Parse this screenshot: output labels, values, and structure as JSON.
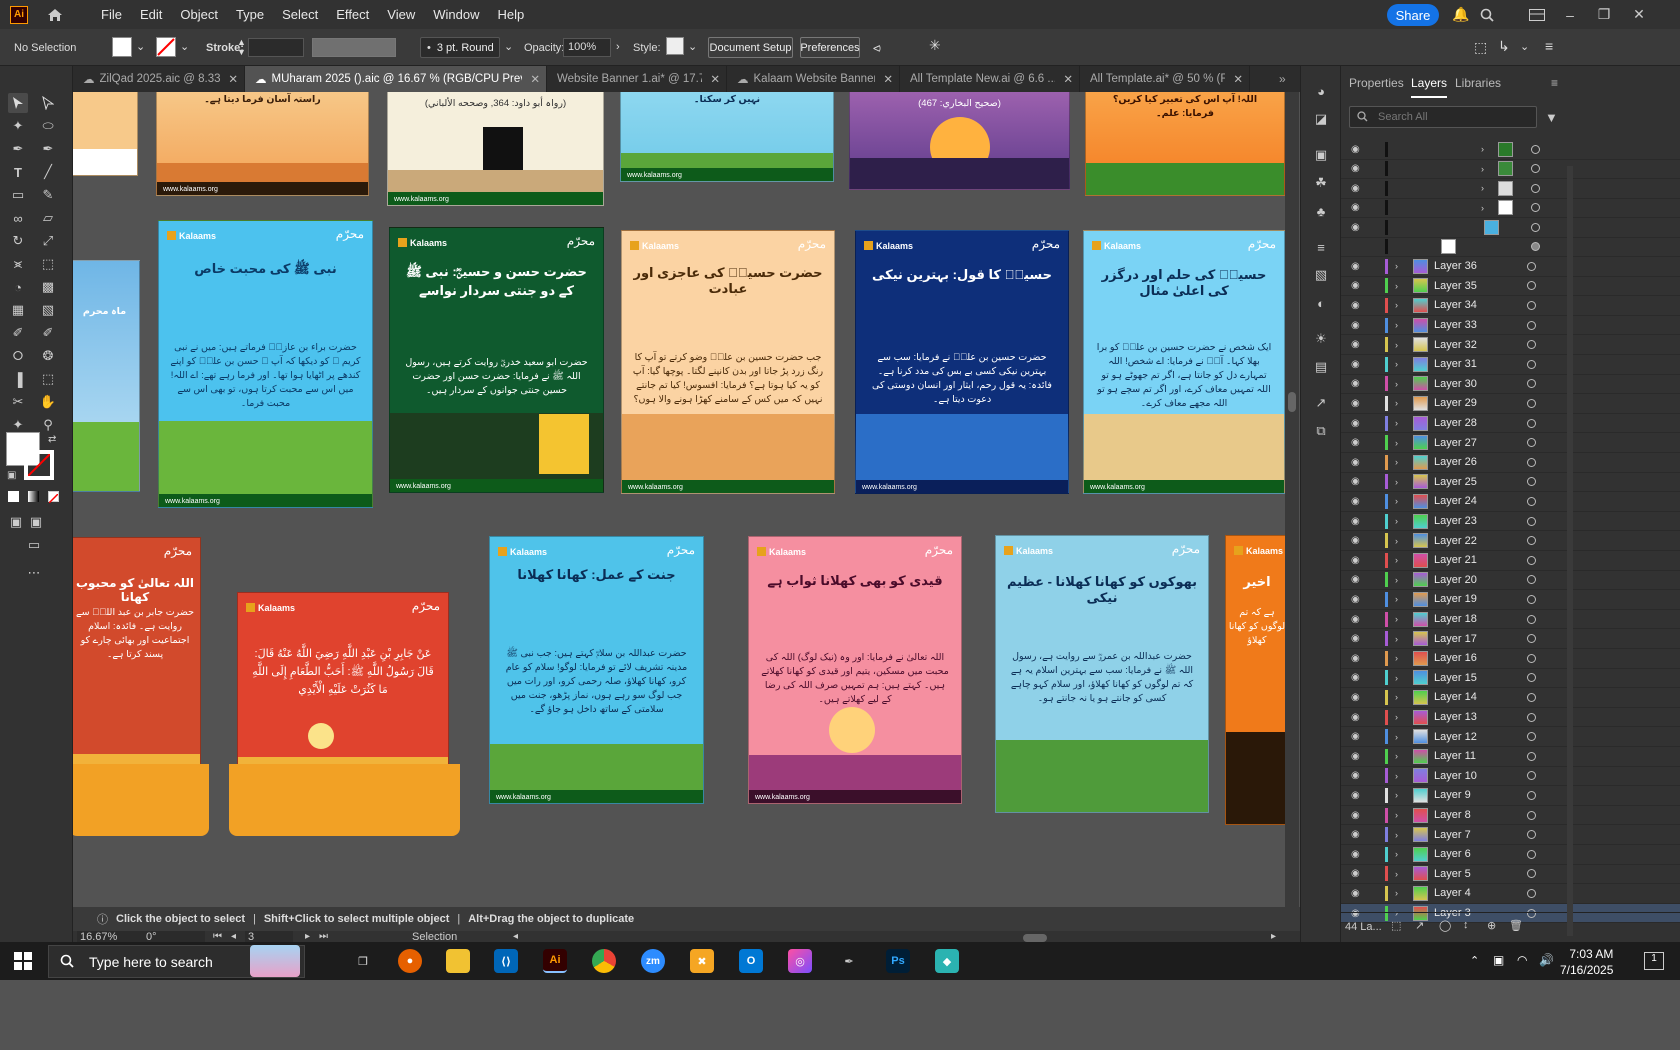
{
  "app": {
    "logo": "Ai",
    "menus": [
      "File",
      "Edit",
      "Object",
      "Type",
      "Select",
      "Effect",
      "View",
      "Window",
      "Help"
    ],
    "share_label": "Share"
  },
  "control": {
    "selection": "No Selection",
    "stroke_label": "Stroke:",
    "brush": "3 pt. Round",
    "opacity_label": "Opacity:",
    "opacity": "100%",
    "style_label": "Style:",
    "doc_setup": "Document Setup",
    "preferences": "Preferences"
  },
  "tabs": [
    {
      "label": "ZilQad 2025.aic @ 8.33 ...",
      "active": false
    },
    {
      "label": "MUharam 2025 ().aic @ 16.67 % (RGB/CPU Preview)",
      "active": true
    },
    {
      "label": "Website Banner 1.ai* @ 17.7...",
      "active": false
    },
    {
      "label": "Kalaam Website Banner.aic",
      "active": false
    },
    {
      "label": "All Template New.ai @ 6.6 ...",
      "active": false
    },
    {
      "label": "All Template.ai* @ 50 % (RG...",
      "active": false
    }
  ],
  "artboards": {
    "brand": "Kalaams",
    "mh": "محرّم",
    "url": "www.kalaams.org",
    "r1": [
      {
        "body": "راستہ آسان فرما دیتا ہے۔",
        "bg": "#f2a154",
        "sky": "#f7c98a",
        "ground": "#d97a33"
      },
      {
        "body": "(رواہ أبو داود: 364, وصححه الألباني)",
        "bg": "#e9e2cf",
        "sky": "#f5efdc",
        "ground": "#caa97a"
      },
      {
        "body": "نہیں کر سکتا۔",
        "bg": "#6ec9e8",
        "sky": "#8fd8f0",
        "ground": "#5aa63a"
      },
      {
        "body": "(صحیح البخاري: 467)",
        "bg": "#5b3a8a",
        "sky": "#8a4b9e",
        "ground": "#2e1f4a"
      },
      {
        "body": "اللہ! آپ اس کی تعبیر کیا کریں؟ فرمایا: علم۔",
        "bg": "#f47b20",
        "sky": "#f9a54a",
        "ground": "#3a8d2b"
      }
    ],
    "r2": [
      {
        "title": "نبی ﷺ کی محبت خاص",
        "body": "حضرت براء بن عازبؓ فرماتے ہیں: میں نے نبی کریم ﷺ کو دیکھا کہ آپ ﷺ حسن بن علیؓ کو اپنے کندھے پر اٹھایا ہوا تھا۔ اور فرما رہے تھے: اے اللہ! میں اس سے محبت کرتا ہوں، تو بھی اس سے محبت فرما۔",
        "bg": "#4cc2ee",
        "tc": "#0b3a66",
        "ground": "#6ab63c"
      },
      {
        "title": "حضرت حسن و حسینؓ: نبی ﷺ کے دو جنتی سردار نواسے",
        "body": "حضرت ابو سعید خدریؓ روایت کرتے ہیں، رسول اللہ ﷺ نے فرمایا: حضرت حسن اور حضرت حسین جنتی جوانوں کے سردار ہیں۔",
        "bg": "#0f5a2e",
        "tc": "#ffffff",
        "ground": "#1d3d1f"
      },
      {
        "title": "حضرت حسینؓ کی عاجزی اور عبادت",
        "body": "جب حضرت حسین بن علیؓ وضو کرتے تو آپ کا رنگ زرد پڑ جاتا اور بدن کانپنے لگتا۔ پوچھا گیا: آپ کو یہ کیا ہوتا ہے؟ فرمایا: افسوس! کیا تم جانتے نہیں کہ میں کس کے سامنے کھڑا ہونے والا ہوں؟",
        "bg": "#fbd3a3",
        "tc": "#4a2a08",
        "ground": "#e9a35a"
      },
      {
        "title": "حسینؓ کا قول: بہترین نیکی",
        "body": "حضرت حسین بن علیؓ نے فرمایا: سب سے بہترین نیکی کسی بے بس کی مدد کرنا ہے۔ فائدہ: یہ قول رحم، ایثار اور انسان دوستی کی دعوت دیتا ہے۔",
        "bg": "#0e2f7a",
        "tc": "#ffffff",
        "ground": "#2b6ec7"
      },
      {
        "title": "حسینؓ کی حلم اور درگزر کی اعلیٰ مثال",
        "body": "ایک شخص نے حضرت حسین بن علیؓ کو برا بھلا کہا۔ آپؓ نے فرمایا: اے شخص! اللہ تمہارے دل کو جانتا ہے، اگر تم جھوٹے ہو تو اللہ تمہیں معاف کرے، اور اگر تم سچے ہو تو اللہ مجھے معاف کرے۔",
        "bg": "#7ad3f5",
        "tc": "#0b2d55",
        "ground": "#e8c98a"
      }
    ],
    "r3": [
      {
        "title": "اللہ تعالیٰ کو محبوب کھانا",
        "body": "حضرت جابر بن عبد اللہؓ سے روایت ہے۔ فائدہ: اسلام اجتماعیت اور بھائی چارے کو پسند کرتا ہے۔",
        "bg": "#d24a2c",
        "tc": "#ffffff"
      },
      {
        "title": "",
        "body": "عَنْ جَابِرِ بْنِ عَبْدِ اللَّهِ رَضِيَ اللَّهُ عَنْهُ قَالَ: قَالَ رَسُولُ اللَّهِ ﷺ: أَحَبُّ الطَّعَامِ إِلَى اللَّهِ مَا كَثُرَتْ عَلَيْهِ الْأَيْدِي",
        "bg": "#e0432e",
        "tc": "#ffffff"
      },
      {
        "title": "جنت کے عمل: کھانا کھلانا",
        "body": "حضرت عبداللہ بن سلامؓ کہتے ہیں: جب نبی ﷺ مدینہ تشریف لائے تو فرمایا: لوگو! سلام کو عام کرو، کھانا کھلاؤ، صلہ رحمی کرو، اور رات میں جب لوگ سو رہے ہوں، نماز پڑھو، جنت میں سلامتی کے ساتھ داخل ہو جاؤ گے۔",
        "bg": "#4fc3ea",
        "tc": "#0b2d55"
      },
      {
        "title": "قیدی کو بھی کھلانا ثواب ہے",
        "body": "اللہ تعالیٰ نے فرمایا: اور وہ (نیک لوگ) اللہ کی محبت میں مسکین، یتیم اور قیدی کو کھانا کھلاتے ہیں۔ کہتے ہیں: ہم تمہیں صرف اللہ کی رضا کے لیے کھلاتے ہیں۔",
        "bg": "#f58fa0",
        "tc": "#4a0b2a"
      },
      {
        "title": "بھوکوں کو کھانا کھلانا - عظیم نیکی",
        "body": "حضرت عبداللہ بن عمروؓ سے روایت ہے، رسول اللہ ﷺ نے فرمایا: سب سے بہترین اسلام یہ ہے کہ تم لوگوں کو کھانا کھلاؤ، اور سلام کہو چاہے کسی کو جانتے ہو یا نہ جانتے ہو۔",
        "bg": "#8fd1e8",
        "tc": "#0b2d55"
      },
      {
        "title": "اخیر",
        "body": "ہے کہ تم لوگوں کو کھانا کھلاؤ",
        "bg": "#f07a1a",
        "tc": "#ffffff"
      }
    ],
    "side": [
      {
        "body": "ماہ محرم",
        "bg": "#6fb6e6"
      }
    ]
  },
  "status": {
    "hint1": "Click the object to select",
    "hint2": "Shift+Click to select multiple object",
    "hint3": "Alt+Drag the object to duplicate",
    "zoom": "16.67%",
    "rotate": "0°",
    "artboard_num": "3",
    "mode": "Selection"
  },
  "panel": {
    "tabs": [
      "Properties",
      "Layers",
      "Libraries"
    ],
    "search_placeholder": "Search All",
    "count": "44 La...",
    "layers": [
      "Layer 36",
      "Layer 35",
      "Layer 34",
      "Layer 33",
      "Layer 32",
      "Layer 31",
      "Layer 30",
      "Layer 29",
      "Layer 28",
      "Layer 27",
      "Layer 26",
      "Layer 25",
      "Layer 24",
      "Layer 23",
      "Layer 22",
      "Layer 21",
      "Layer 20",
      "Layer 19",
      "Layer 18",
      "Layer 17",
      "Layer 16",
      "Layer 15",
      "Layer 14",
      "Layer 13",
      "Layer 12",
      "Layer 11",
      "Layer 10",
      "Layer 9",
      "Layer 8",
      "Layer 7",
      "Layer 6",
      "Layer 5",
      "Layer 4",
      "Layer 3"
    ],
    "layer_colors": [
      "#a75cd6",
      "#4fcf4f",
      "#e04f4f",
      "#4f8fe0",
      "#d6c54f",
      "#4fcfcf",
      "#cf4fa8",
      "#e0e0e0",
      "#7f7fe0",
      "#4fcf4f",
      "#e09a4f",
      "#a75cd6",
      "#4f8fe0",
      "#4fcfcf",
      "#d6c54f",
      "#e04f4f",
      "#4fcf4f",
      "#4f8fe0",
      "#cf4fa8",
      "#a75cd6",
      "#e09a4f",
      "#4fcfcf",
      "#d6c54f",
      "#e04f4f",
      "#4f8fe0",
      "#4fcf4f",
      "#a75cd6",
      "#e0e0e0",
      "#cf4fa8",
      "#7f7fe0",
      "#4fcfcf",
      "#e04f4f",
      "#d6c54f",
      "#4fcf4f"
    ]
  },
  "taskbar": {
    "search": "Type here to search",
    "time": "7:03 AM",
    "date": "7/16/2025",
    "notif": "1"
  }
}
